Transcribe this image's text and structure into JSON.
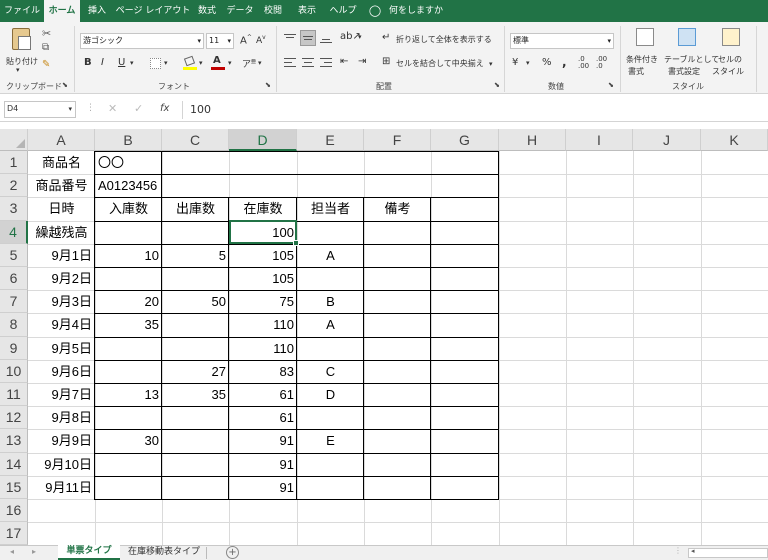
{
  "menu_tabs": [
    "ファイル",
    "ホーム",
    "挿入",
    "ページ レイアウト",
    "数式",
    "データ",
    "校閲",
    "表示",
    "ヘルプ"
  ],
  "tell_me": "何をしますか",
  "ribbon": {
    "paste": "貼り付け",
    "clipboard_group": "クリップボード",
    "font_name": "游ゴシック",
    "font_size": "11",
    "font_group": "フォント",
    "wrap_text": "折り返して全体を表示する",
    "merge_center": "セルを結合して中央揃え",
    "alignment_group": "配置",
    "number_format": "標準",
    "number_group": "数値",
    "cond_format_1": "条件付き",
    "cond_format_2": "書式",
    "table_format_1": "テーブルとして",
    "table_format_2": "書式設定",
    "cell_style_1": "セルの",
    "cell_style_2": "スタイル",
    "style_group": "スタイル",
    "bold": "B",
    "italic": "I",
    "underline": "U",
    "percent": "%",
    "comma": ","
  },
  "formula_bar": {
    "name_box": "D4",
    "formula": "100",
    "fx": "fx"
  },
  "columns": [
    "A",
    "B",
    "C",
    "D",
    "E",
    "F",
    "G",
    "H",
    "I",
    "J",
    "K"
  ],
  "selected_column": "D",
  "rows": [
    "1",
    "2",
    "3",
    "4",
    "5",
    "6",
    "7",
    "8",
    "9",
    "10",
    "11",
    "12",
    "13",
    "14",
    "15",
    "16",
    "17"
  ],
  "selected_row": "4",
  "sheet": {
    "product_name_label": "商品名",
    "product_name_value": "〇〇",
    "product_code_label": "商品番号",
    "product_code_value": "A0123456",
    "headers": [
      "日時",
      "入庫数",
      "出庫数",
      "在庫数",
      "担当者",
      "備考"
    ],
    "data_rows": [
      [
        "繰越残高",
        "",
        "",
        "100",
        "",
        ""
      ],
      [
        "9月1日",
        "10",
        "5",
        "105",
        "A",
        ""
      ],
      [
        "9月2日",
        "",
        "",
        "105",
        "",
        ""
      ],
      [
        "9月3日",
        "20",
        "50",
        "75",
        "B",
        ""
      ],
      [
        "9月4日",
        "35",
        "",
        "110",
        "A",
        ""
      ],
      [
        "9月5日",
        "",
        "",
        "110",
        "",
        ""
      ],
      [
        "9月6日",
        "",
        "27",
        "83",
        "C",
        ""
      ],
      [
        "9月7日",
        "13",
        "35",
        "61",
        "D",
        ""
      ],
      [
        "9月8日",
        "",
        "",
        "61",
        "",
        ""
      ],
      [
        "9月9日",
        "30",
        "",
        "91",
        "E",
        ""
      ],
      [
        "9月10日",
        "",
        "",
        "91",
        "",
        ""
      ],
      [
        "9月11日",
        "",
        "",
        "91",
        "",
        ""
      ]
    ]
  },
  "sheet_tabs": [
    "単票タイプ",
    "在庫移動表タイプ"
  ],
  "active_sheet": "単票タイプ",
  "colors": {
    "accent": "#217346",
    "ribbon_bg": "#f3f3f3",
    "header_bg": "#e6e6e6",
    "font_red": "#c00000",
    "highlight_yellow": "#ffff00"
  }
}
